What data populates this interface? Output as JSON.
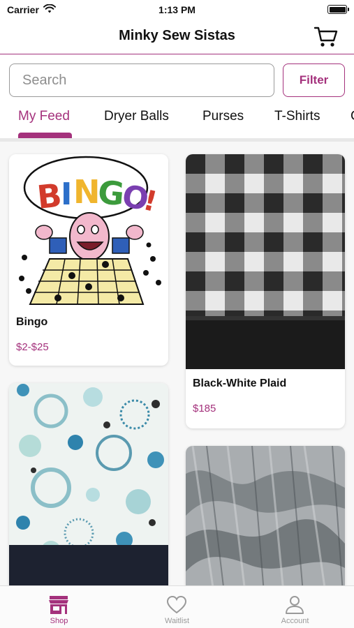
{
  "status_bar": {
    "carrier": "Carrier",
    "time": "1:13 PM"
  },
  "header": {
    "title": "Minky Sew Sistas",
    "cart_icon": "cart-icon"
  },
  "search": {
    "placeholder": "Search",
    "value": "",
    "filter_label": "Filter"
  },
  "tabs": [
    {
      "label": "My Feed",
      "active": true
    },
    {
      "label": "Dryer Balls",
      "active": false
    },
    {
      "label": "Purses",
      "active": false
    },
    {
      "label": "T-Shirts",
      "active": false
    },
    {
      "label": "C",
      "active": false
    }
  ],
  "products": [
    {
      "name": "Bingo",
      "price": "$2-$25",
      "image": "bingo cartoon illustration",
      "logo_text": "BINGO!"
    },
    {
      "name": "Black-White Plaid",
      "price": "$185",
      "image": "black and white buffalo plaid minky fabric"
    },
    {
      "name": "",
      "price": "",
      "image": "teal circles print fabric with black minky"
    },
    {
      "name": "",
      "price": "",
      "image": "grey faux fur minky fabric"
    }
  ],
  "tab_bar": [
    {
      "label": "Shop",
      "icon": "shop-icon",
      "active": true
    },
    {
      "label": "Waitlist",
      "icon": "heart-icon",
      "active": false
    },
    {
      "label": "Account",
      "icon": "account-icon",
      "active": false
    }
  ],
  "colors": {
    "accent": "#a4317c",
    "inactive": "#9a9a9a"
  }
}
